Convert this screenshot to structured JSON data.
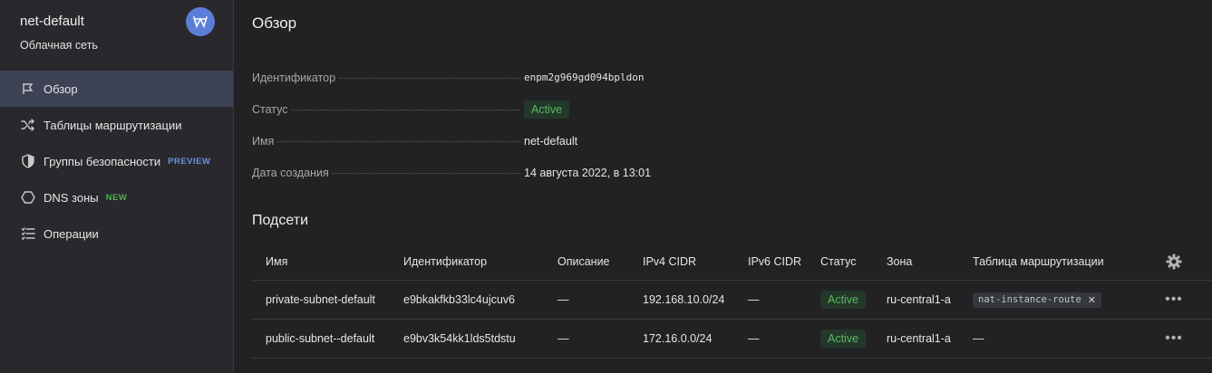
{
  "sidebar": {
    "title": "net-default",
    "subtitle": "Облачная сеть",
    "badge_icon": "network-icon",
    "items": [
      {
        "label": "Обзор",
        "icon": "flag-icon",
        "active": true,
        "tag": ""
      },
      {
        "label": "Таблицы маршрутизации",
        "icon": "shuffle-icon",
        "active": false,
        "tag": ""
      },
      {
        "label": "Группы безопасности",
        "icon": "shield-icon",
        "active": false,
        "tag": "PREVIEW"
      },
      {
        "label": "DNS зоны",
        "icon": "hexagon-icon",
        "active": false,
        "tag": "NEW"
      },
      {
        "label": "Операции",
        "icon": "list-icon",
        "active": false,
        "tag": ""
      }
    ]
  },
  "main": {
    "title": "Обзор",
    "properties": {
      "id_label": "Идентификатор",
      "id_value": "enpm2g969gd094bpldon",
      "status_label": "Статус",
      "status_value": "Active",
      "name_label": "Имя",
      "name_value": "net-default",
      "created_label": "Дата создания",
      "created_value": "14 августа 2022, в 13:01"
    },
    "subnets_title": "Подсети",
    "table": {
      "headers": [
        "Имя",
        "Идентификатор",
        "Описание",
        "IPv4 CIDR",
        "IPv6 CIDR",
        "Статус",
        "Зона",
        "Таблица маршрутизации"
      ],
      "rows": [
        {
          "name": "private-subnet-default",
          "id": "e9bkakfkb33lc4ujcuv6",
          "description": "—",
          "ipv4": "192.168.10.0/24",
          "ipv6": "—",
          "status": "Active",
          "zone": "ru-central1-a",
          "route_table": "nat-instance-route",
          "route_remove": "✕",
          "more": "•••"
        },
        {
          "name": "public-subnet--default",
          "id": "e9bv3k54kk1lds5tdstu",
          "description": "—",
          "ipv4": "172.16.0.0/24",
          "ipv6": "—",
          "status": "Active",
          "zone": "ru-central1-a",
          "route_table": "—",
          "more": "•••"
        }
      ]
    }
  },
  "colors": {
    "background": "#222224",
    "sidebar": "#29292d",
    "active_nav": "#3d4355",
    "accent": "#5b7fd9",
    "status_green": "#55b95a"
  }
}
